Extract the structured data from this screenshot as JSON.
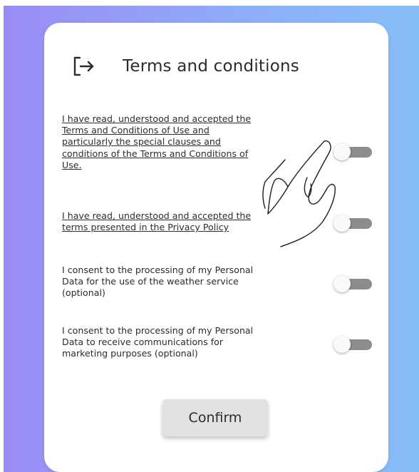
{
  "header": {
    "title": "Terms and conditions",
    "icon": "logout-icon"
  },
  "consents": [
    {
      "text": "I have read, understood and accepted the\nTerms and Conditions of Use and\nparticularly the special clauses and\nconditions of the Terms and Conditions of\nUse.",
      "is_link": true,
      "toggle_on": false
    },
    {
      "text": "I have read, understood and accepted the\nterms presented in the Privacy Policy",
      "is_link": true,
      "toggle_on": false
    },
    {
      "text": "I consent to the processing of my Personal\nData for the use of the weather service\n(optional)",
      "is_link": false,
      "toggle_on": false
    },
    {
      "text": "I consent to the processing of my Personal\nData to receive communications for\nmarketing purposes (optional)",
      "is_link": false,
      "toggle_on": false
    }
  ],
  "confirm_label": "Confirm",
  "colors": {
    "background_start": "#9a8cf6",
    "background_end": "#86bff8",
    "card": "#ffffff",
    "toggle_track": "#8c8c8c",
    "toggle_knob": "#fafafa",
    "button": "#e2e2e2"
  },
  "overlay": {
    "icon": "pointing-hand-icon"
  }
}
